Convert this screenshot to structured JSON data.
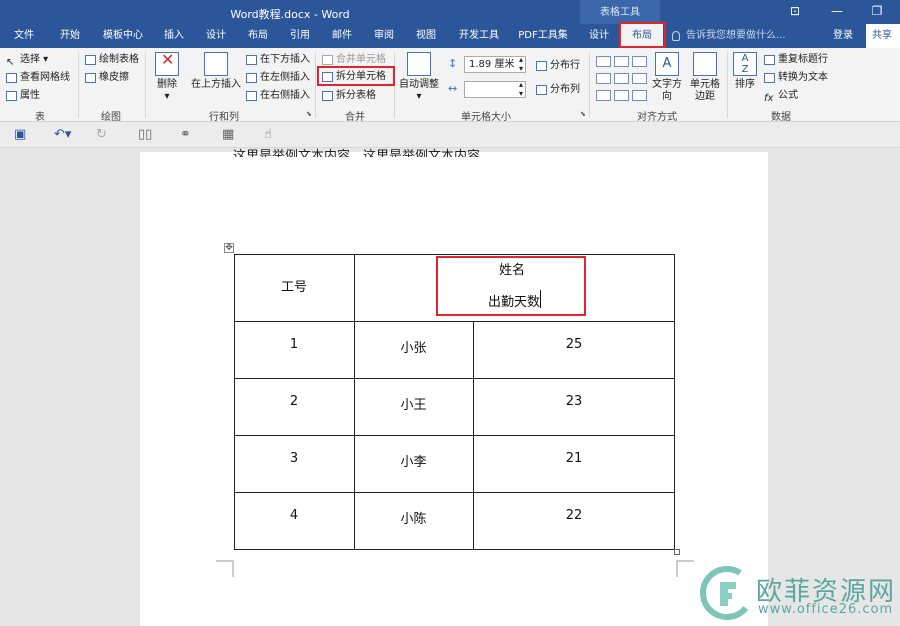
{
  "window": {
    "title": "Word教程.docx - Word",
    "context_tab_group": "表格工具",
    "controls": [
      "⊡",
      "—",
      "❐"
    ]
  },
  "tabs": [
    "文件",
    "开始",
    "模板中心",
    "插入",
    "设计",
    "布局",
    "引用",
    "邮件",
    "审阅",
    "视图",
    "开发工具",
    "PDF工具集",
    "设计",
    "布局"
  ],
  "active_tab": "布局",
  "tellme": "告诉我您想要做什么...",
  "login": "登录",
  "share": "共享",
  "ribbon": {
    "table": {
      "label": "表",
      "select": "选择",
      "gridlines": "查看网格线",
      "properties": "属性"
    },
    "draw": {
      "label": "绘图",
      "draw_table": "绘制表格",
      "eraser": "橡皮擦"
    },
    "rows_cols": {
      "label": "行和列",
      "delete": "删除",
      "insert_above": "在上方插入",
      "insert_below": "在下方插入",
      "insert_left": "在左侧插入",
      "insert_right": "在右侧插入"
    },
    "merge": {
      "label": "合并",
      "merge_cells": "合并单元格",
      "split_cells": "拆分单元格",
      "split_table": "拆分表格"
    },
    "cell_size": {
      "label": "单元格大小",
      "autofit": "自动调整",
      "height": "1.89 厘米",
      "width": "",
      "distribute_rows": "分布行",
      "distribute_cols": "分布列"
    },
    "alignment": {
      "label": "对齐方式",
      "text_direction": "文字方向",
      "cell_margins": "单元格边距"
    },
    "data": {
      "label": "数据",
      "sort": "排序",
      "repeat_header": "重复标题行",
      "convert_text": "转换为文本",
      "formula": "公式"
    }
  },
  "document": {
    "paragraph": "这里是举例文本内容，这里是举例文本内容。",
    "table": {
      "header": [
        "工号",
        "姓名",
        "出勤天数"
      ],
      "rows": [
        [
          "1",
          "小张",
          "25"
        ],
        [
          "2",
          "小王",
          "23"
        ],
        [
          "3",
          "小李",
          "21"
        ],
        [
          "4",
          "小陈",
          "22"
        ]
      ]
    }
  },
  "watermark": {
    "name": "欧菲资源网",
    "url": "www.office26.com"
  }
}
